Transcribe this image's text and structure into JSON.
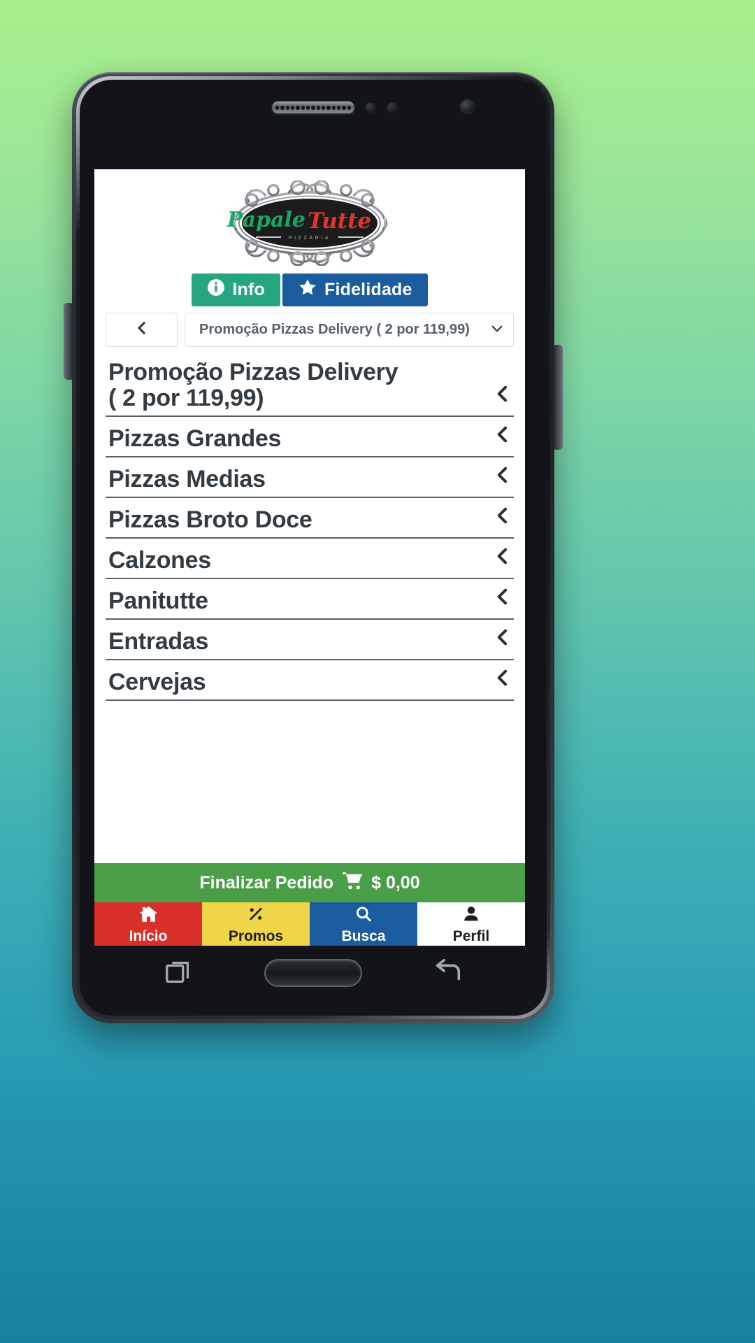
{
  "brand": {
    "name_part1": "Papale",
    "name_part2": "Tutte",
    "subtitle": "P I Z Z A R I A",
    "color_green": "#16a868",
    "color_red": "#e2352b",
    "logo_alt": "Papale Tutte Pizzaria"
  },
  "actions": {
    "info": {
      "label": "Info",
      "icon": "info-circle-icon",
      "color": "#25a67f"
    },
    "fidelidade": {
      "label": "Fidelidade",
      "icon": "star-icon",
      "color": "#1a5c9e"
    }
  },
  "nav": {
    "back_icon": "chevron-left-icon",
    "selected_category": "Promoção Pizzas Delivery ( 2 por 119,99)",
    "select_caret_icon": "chevron-down-icon"
  },
  "categories": [
    {
      "label": "Promoção Pizzas Delivery ( 2 por 119,99)",
      "chevron": "chevron-left-icon"
    },
    {
      "label": "Pizzas Grandes",
      "chevron": "chevron-left-icon"
    },
    {
      "label": "Pizzas Medias",
      "chevron": "chevron-left-icon"
    },
    {
      "label": "Pizzas Broto Doce",
      "chevron": "chevron-left-icon"
    },
    {
      "label": "Calzones",
      "chevron": "chevron-left-icon"
    },
    {
      "label": "Panitutte",
      "chevron": "chevron-left-icon"
    },
    {
      "label": "Entradas",
      "chevron": "chevron-left-icon"
    },
    {
      "label": "Cervejas",
      "chevron": "chevron-left-icon"
    }
  ],
  "checkout": {
    "label": "Finalizar Pedido",
    "cart_icon": "shopping-cart-icon",
    "total": "$ 0,00",
    "color": "#4a9e47"
  },
  "tabs": [
    {
      "label": "Início",
      "icon": "home-icon",
      "bg": "#d9302a",
      "fg": "#ffffff"
    },
    {
      "label": "Promos",
      "icon": "percent-icon",
      "bg": "#f1d549",
      "fg": "#1f1f1f"
    },
    {
      "label": "Busca",
      "icon": "search-icon",
      "bg": "#1a5c9e",
      "fg": "#ffffff"
    },
    {
      "label": "Perfil",
      "icon": "user-icon",
      "bg": "#ffffff",
      "fg": "#1f1f1f"
    }
  ],
  "device": {
    "speaker": "earpiece-speaker",
    "camera": "front-camera",
    "home_key": "home-button",
    "recents_key": "recent-apps-button",
    "back_key": "back-button"
  }
}
